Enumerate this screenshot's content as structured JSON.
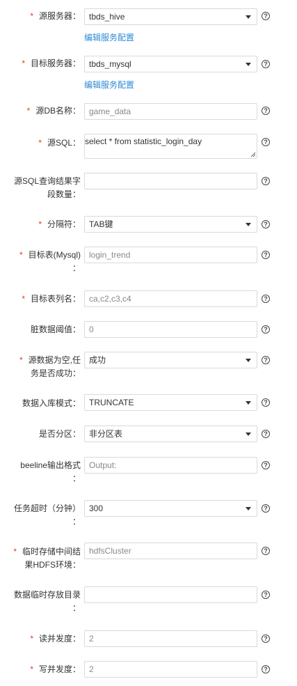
{
  "fields": {
    "source_server": {
      "label": "源服务器：",
      "value": "tbds_hive",
      "link": "编辑服务配置"
    },
    "target_server": {
      "label": "目标服务器：",
      "value": "tbds_mysql",
      "link": "编辑服务配置"
    },
    "source_db_name": {
      "label": "源DB名称：",
      "placeholder": "game_data"
    },
    "source_sql": {
      "label": "源SQL：",
      "value": "select * from statistic_login_day"
    },
    "result_field_count": {
      "label_line1": "源SQL查询结果字",
      "label_line2": "段数量："
    },
    "delimiter": {
      "label": "分隔符：",
      "value": "TAB键"
    },
    "target_table": {
      "label_line1": "目标表(Mysql)",
      "label_line2": "：",
      "placeholder": "login_trend"
    },
    "target_columns": {
      "label": "目标表列名：",
      "placeholder": "ca,c2,c3,c4"
    },
    "dirty_threshold": {
      "label": "脏数据阈值：",
      "placeholder": "0"
    },
    "empty_source_success": {
      "label_line1": "源数据为空,任",
      "label_line2": "务是否成功：",
      "value": "成功"
    },
    "load_mode": {
      "label": "数据入库模式：",
      "value": "TRUNCATE"
    },
    "partitioned": {
      "label": "是否分区：",
      "value": "非分区表"
    },
    "beeline_format": {
      "label_line1": "beeline输出格式",
      "label_line2": "：",
      "placeholder": "Output:"
    },
    "timeout": {
      "label_line1": "任务超时（分钟）",
      "label_line2": "：",
      "value": "300"
    },
    "temp_hdfs_env": {
      "label_line1": "临时存储中间结",
      "label_line2": "果HDFS环境：",
      "placeholder": "hdfsCluster"
    },
    "temp_dir": {
      "label_line1": "数据临时存放目录",
      "label_line2": "："
    },
    "read_concurrency": {
      "label": "读并发度：",
      "placeholder": "2"
    },
    "write_concurrency": {
      "label": "写并发度：",
      "placeholder": "2"
    }
  },
  "help_glyph": "?",
  "required_mark": "*"
}
